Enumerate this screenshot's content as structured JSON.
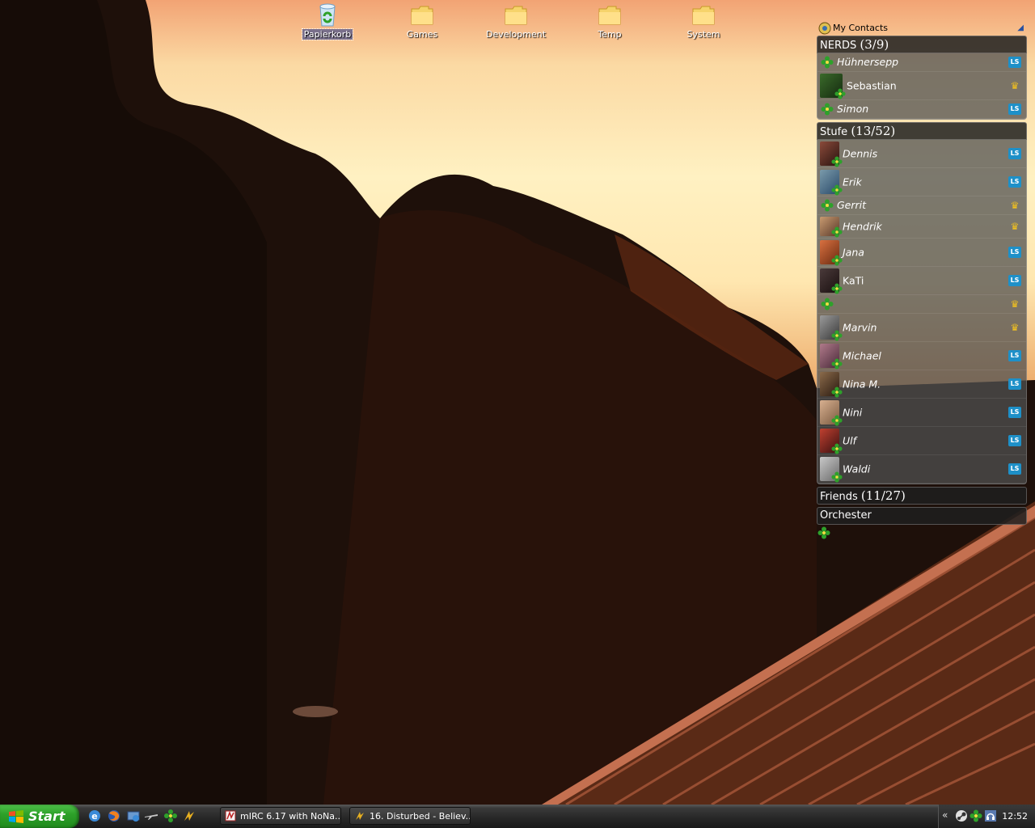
{
  "desktop": {
    "icons": [
      {
        "label": "Papierkorb",
        "icon": "recycle-bin-icon"
      },
      {
        "label": "Games",
        "icon": "folder-icon"
      },
      {
        "label": "Development",
        "icon": "folder-icon"
      },
      {
        "label": "Temp",
        "icon": "folder-icon"
      },
      {
        "label": "System",
        "icon": "folder-icon"
      }
    ]
  },
  "contacts": {
    "title": "My Contacts",
    "groups": [
      {
        "name": "NERDS",
        "count": "(3/9)",
        "members": [
          {
            "name": "Hühnersepp",
            "client": "ls"
          },
          {
            "name": "Sebastian",
            "client": "crown"
          },
          {
            "name": "Simon",
            "client": "ls"
          }
        ]
      },
      {
        "name": "Stufe",
        "count": "(13/52)",
        "members": [
          {
            "name": "Dennis",
            "client": "ls"
          },
          {
            "name": "Erik",
            "client": "ls"
          },
          {
            "name": "Gerrit",
            "client": "crown"
          },
          {
            "name": "Hendrik",
            "client": "crown"
          },
          {
            "name": "Jana",
            "client": "ls"
          },
          {
            "name": "KaTi",
            "client": "ls"
          },
          {
            "name": "",
            "client": "crown"
          },
          {
            "name": "Marvin",
            "client": "crown"
          },
          {
            "name": "Michael",
            "client": "ls"
          },
          {
            "name": "Nina M.",
            "client": "ls"
          },
          {
            "name": "Nini",
            "client": "ls"
          },
          {
            "name": "Ulf",
            "client": "ls"
          },
          {
            "name": "Waldi",
            "client": "ls"
          }
        ]
      },
      {
        "name": "Friends",
        "count": "(11/27)"
      },
      {
        "name": "Orchester",
        "count": ""
      }
    ]
  },
  "taskbar": {
    "start_label": "Start",
    "quicklaunch": [
      "ie-icon",
      "firefox-icon",
      "network-icon",
      "plane-icon",
      "icq-icon",
      "winamp-icon"
    ],
    "tasks": [
      {
        "label": "mIRC 6.17 with NoNa...",
        "icon": "mirc-icon"
      },
      {
        "label": "16. Disturbed - Believ...",
        "icon": "winamp-icon"
      }
    ],
    "tray": {
      "chevron": "«",
      "icons": [
        "steam-icon",
        "icq-icon",
        "headphones-icon"
      ],
      "clock": "12:52"
    }
  },
  "colors": {
    "ls_badge": "#1e90c8",
    "crown": "#f0c020",
    "start_green": "#2ea12a"
  }
}
